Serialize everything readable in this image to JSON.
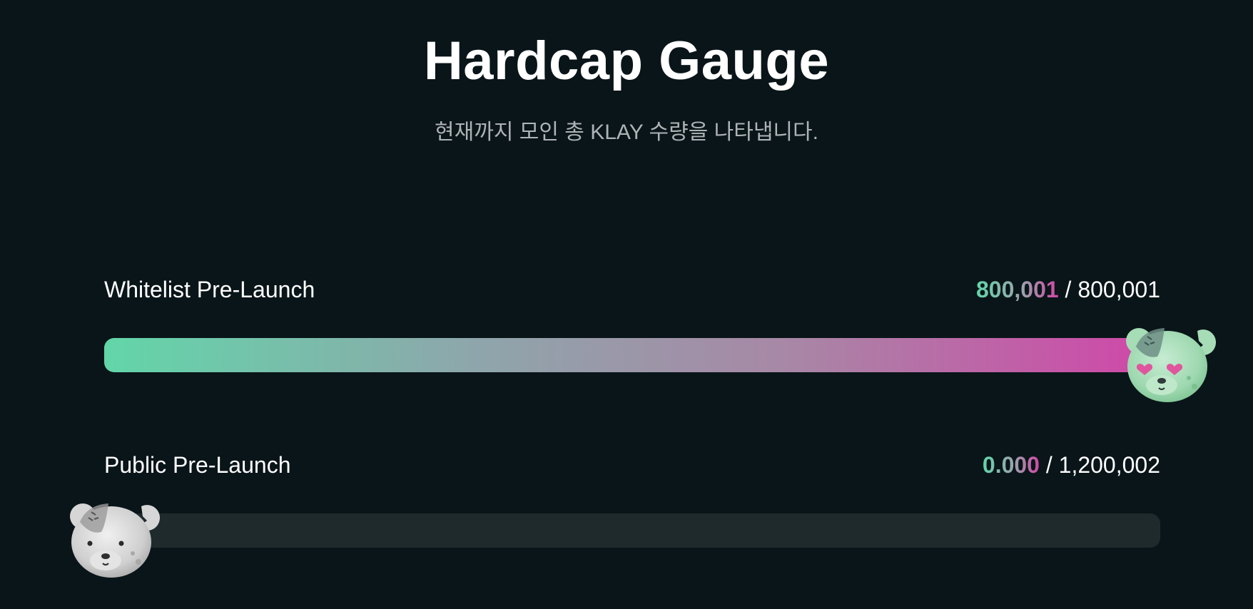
{
  "header": {
    "title": "Hardcap Gauge",
    "subtitle": "현재까지 모인 총 KLAY 수량을 나타냅니다."
  },
  "gauges": [
    {
      "label": "Whitelist Pre-Launch",
      "current": "800,001",
      "separator": " / ",
      "total": "800,001",
      "progress": 1.0,
      "mascot": "bear-green-heart-eyes-icon"
    },
    {
      "label": "Public Pre-Launch",
      "current": "0.000",
      "separator": " / ",
      "total": "1,200,002",
      "progress": 0.0,
      "mascot": "bear-grey-icon"
    }
  ],
  "colors": {
    "background": "#0a1519",
    "track": "#1f2a2d",
    "gradient_start": "#62d6a9",
    "gradient_end": "#d046a8"
  }
}
